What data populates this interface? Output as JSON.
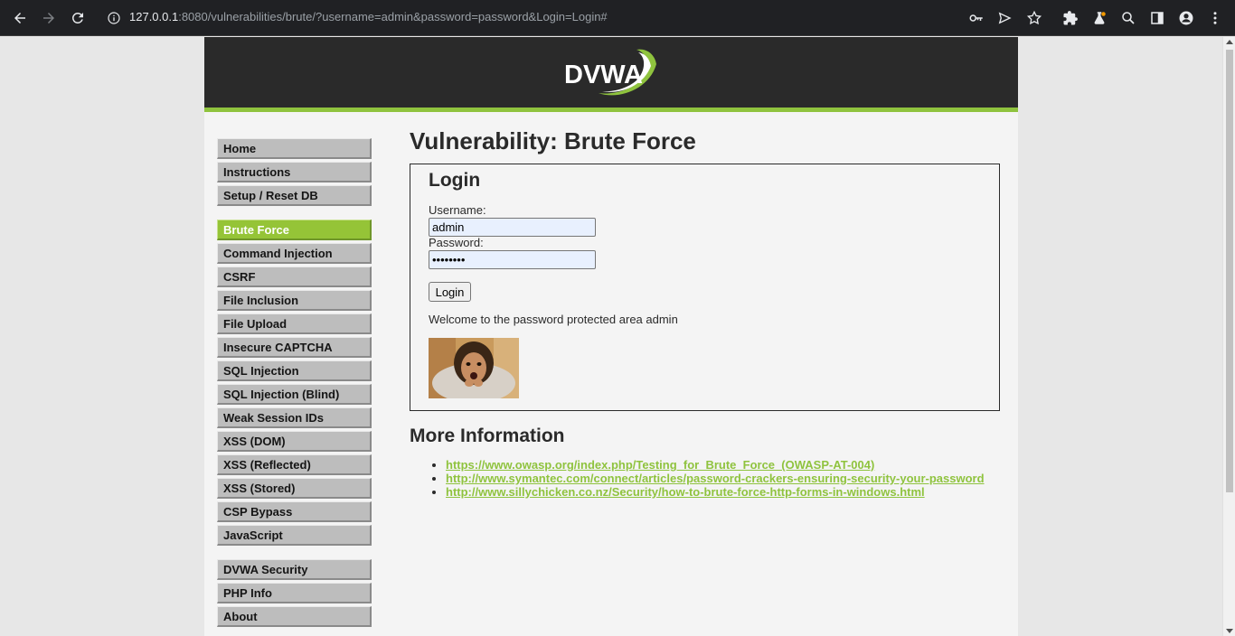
{
  "browser": {
    "url_host": "127.0.0.1",
    "url_rest": ":8080/vulnerabilities/brute/?username=admin&password=password&Login=Login#"
  },
  "menu": {
    "group1": [
      "Home",
      "Instructions",
      "Setup / Reset DB"
    ],
    "group2": [
      "Brute Force",
      "Command Injection",
      "CSRF",
      "File Inclusion",
      "File Upload",
      "Insecure CAPTCHA",
      "SQL Injection",
      "SQL Injection (Blind)",
      "Weak Session IDs",
      "XSS (DOM)",
      "XSS (Reflected)",
      "XSS (Stored)",
      "CSP Bypass",
      "JavaScript"
    ],
    "group3": [
      "DVWA Security",
      "PHP Info",
      "About"
    ],
    "active": "Brute Force"
  },
  "main": {
    "title": "Vulnerability: Brute Force",
    "login_title": "Login",
    "username_label": "Username:",
    "username_value": "admin",
    "password_label": "Password:",
    "password_value": "password",
    "login_button": "Login",
    "welcome": "Welcome to the password protected area admin",
    "more_title": "More Information",
    "links": [
      "https://www.owasp.org/index.php/Testing_for_Brute_Force_(OWASP-AT-004)",
      "http://www.symantec.com/connect/articles/password-crackers-ensuring-security-your-password",
      "http://www.sillychicken.co.nz/Security/how-to-brute-force-http-forms-in-windows.html"
    ]
  },
  "logo_text": "DVWA",
  "colors": {
    "accent": "#8fc33e",
    "header_bg": "#2a2a2a",
    "page_bg": "#f4f4f4"
  }
}
